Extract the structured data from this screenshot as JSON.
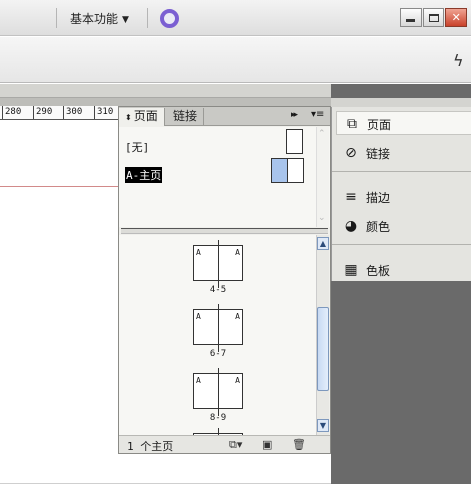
{
  "appbar": {
    "workspace_label": "基本功能",
    "workspace_caret": "▼"
  },
  "ruler": {
    "ticks": [
      "280",
      "290",
      "300",
      "310"
    ]
  },
  "panel": {
    "tabs": [
      {
        "label": "页面",
        "arrow": "⬍"
      },
      {
        "label": "链接"
      }
    ],
    "fastforward": "▸▸",
    "menu_icon": "▾≡",
    "masters": [
      {
        "label": "[无]"
      },
      {
        "label": "A-主页"
      }
    ],
    "page_letter": "A",
    "spreads": [
      {
        "label": "4-5"
      },
      {
        "label": "6-7"
      },
      {
        "label": "8-9"
      }
    ],
    "footer_count": "1 个主页"
  },
  "dock": {
    "items": [
      {
        "label": "页面",
        "icon": "pages-icon",
        "glyph": "⧉"
      },
      {
        "label": "链接",
        "icon": "links-icon",
        "glyph": "⊘"
      },
      {
        "label": "描边",
        "icon": "stroke-icon",
        "glyph": "≡"
      },
      {
        "label": "颜色",
        "icon": "color-icon",
        "glyph": "◕"
      },
      {
        "label": "色板",
        "icon": "swatches-icon",
        "glyph": "▦"
      }
    ]
  },
  "colors": {
    "accent_ring": "#7b5fd2",
    "selected_master": "#a8c4ec",
    "dock_bg": "#6a6a6a"
  }
}
